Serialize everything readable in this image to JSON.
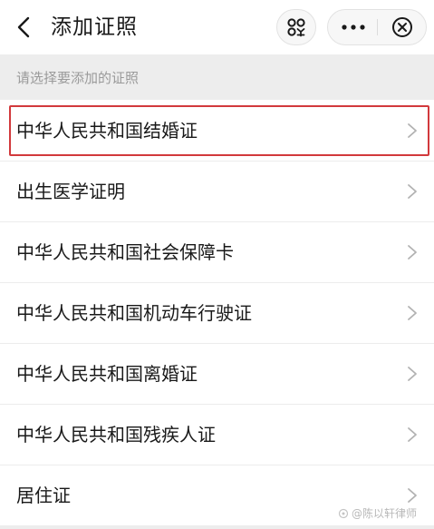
{
  "header": {
    "title": "添加证照",
    "back_icon": "chevron-left-icon",
    "scan_icon": "scan-icon",
    "more_icon": "more-dots-icon",
    "close_icon": "close-circle-icon"
  },
  "section_hint": "请选择要添加的证照",
  "items": [
    {
      "label": "中华人民共和国结婚证",
      "highlighted": true
    },
    {
      "label": "出生医学证明"
    },
    {
      "label": "中华人民共和国社会保障卡"
    },
    {
      "label": "中华人民共和国机动车行驶证"
    },
    {
      "label": "中华人民共和国离婚证"
    },
    {
      "label": "中华人民共和国残疾人证"
    },
    {
      "label": "居住证"
    }
  ],
  "watermark": "@陈以轩律师",
  "colors": {
    "highlight_border": "#d2393c",
    "background": "#ededed",
    "hint_text": "#9a9a9a"
  }
}
